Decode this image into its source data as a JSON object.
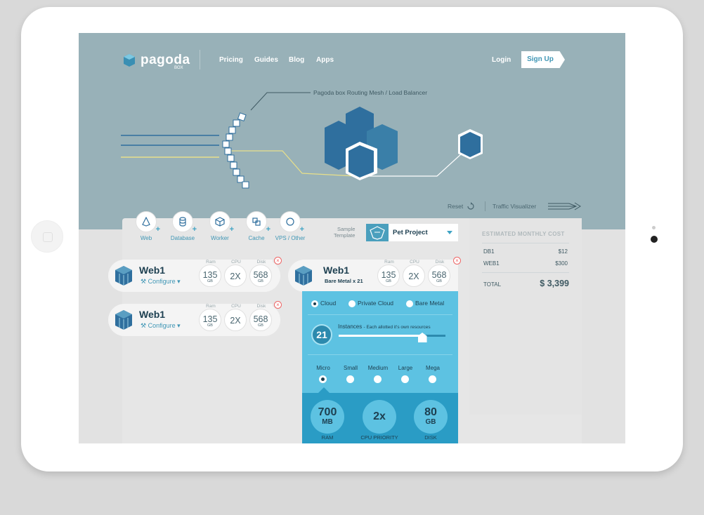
{
  "brand": {
    "name": "pagoda",
    "sub": "BOX"
  },
  "nav": {
    "links": [
      "Pricing",
      "Guides",
      "Blog",
      "Apps"
    ],
    "login": "Login",
    "signup": "Sign Up"
  },
  "hero": {
    "mesh_label": "Pagoda box Routing Mesh / Load Balancer",
    "reset": "Reset",
    "traffic": "Traffic Visualizer"
  },
  "services": [
    {
      "label": "Web",
      "icon": "web-icon"
    },
    {
      "label": "Database",
      "icon": "database-icon"
    },
    {
      "label": "Worker",
      "icon": "worker-icon"
    },
    {
      "label": "Cache",
      "icon": "cache-icon"
    },
    {
      "label": "VPS / Other",
      "icon": "vps-icon"
    }
  ],
  "sample": {
    "label_line1": "Sample",
    "label_line2": "Template",
    "value": "Pet Project"
  },
  "estimate": {
    "title": "ESTIMATED MONTHLY COST",
    "rows": [
      {
        "name": "DB1",
        "value": "$12"
      },
      {
        "name": "WEB1",
        "value": "$300"
      }
    ],
    "total_label": "TOTAL",
    "total_value": "$ 3,399"
  },
  "cards": [
    {
      "title": "Web1",
      "configure": "Configure ▾",
      "ram_k": "Ram",
      "ram_v": "135",
      "ram_u": "GB",
      "cpu_k": "CPU",
      "cpu_v": "2X",
      "disk_k": "Disk",
      "disk_v": "568",
      "disk_u": "GB"
    },
    {
      "title": "Web1",
      "configure": "Configure ▾",
      "ram_k": "Ram",
      "ram_v": "135",
      "ram_u": "GB",
      "cpu_k": "CPU",
      "cpu_v": "2X",
      "disk_k": "Disk",
      "disk_v": "568",
      "disk_u": "GB"
    },
    {
      "title": "Web1",
      "subtitle": "Bare Metal x 21",
      "ram_k": "Ram",
      "ram_v": "135",
      "ram_u": "GB",
      "cpu_k": "CPU",
      "cpu_v": "2X",
      "disk_k": "Disk",
      "disk_v": "568",
      "disk_u": "GB"
    }
  ],
  "detail": {
    "hosting": [
      {
        "label": "Cloud",
        "selected": true
      },
      {
        "label": "Private Cloud",
        "selected": false
      },
      {
        "label": "Bare Metal",
        "selected": false
      }
    ],
    "instances_value": "21",
    "instances_label": "Instances",
    "instances_note": "- Each allotted it's own resources",
    "instances_slider_fraction": 0.78,
    "sizes": [
      {
        "label": "Micro",
        "selected": true
      },
      {
        "label": "Small",
        "selected": false
      },
      {
        "label": "Medium",
        "selected": false
      },
      {
        "label": "Large",
        "selected": false
      },
      {
        "label": "Mega",
        "selected": false
      }
    ],
    "ram_v": "700",
    "ram_u": "MB",
    "ram_l": "RAM",
    "cpu_v": "2x",
    "cpu_l": "CPU PRIORITY",
    "disk_v": "80",
    "disk_u": "GB",
    "disk_l": "DISK"
  },
  "close_symbol": "×",
  "colors": {
    "hero": "#98b1b8",
    "accent": "#3f96b5",
    "panel_blue": "#5dc2e2",
    "panel_dark": "#2a9cc5"
  }
}
